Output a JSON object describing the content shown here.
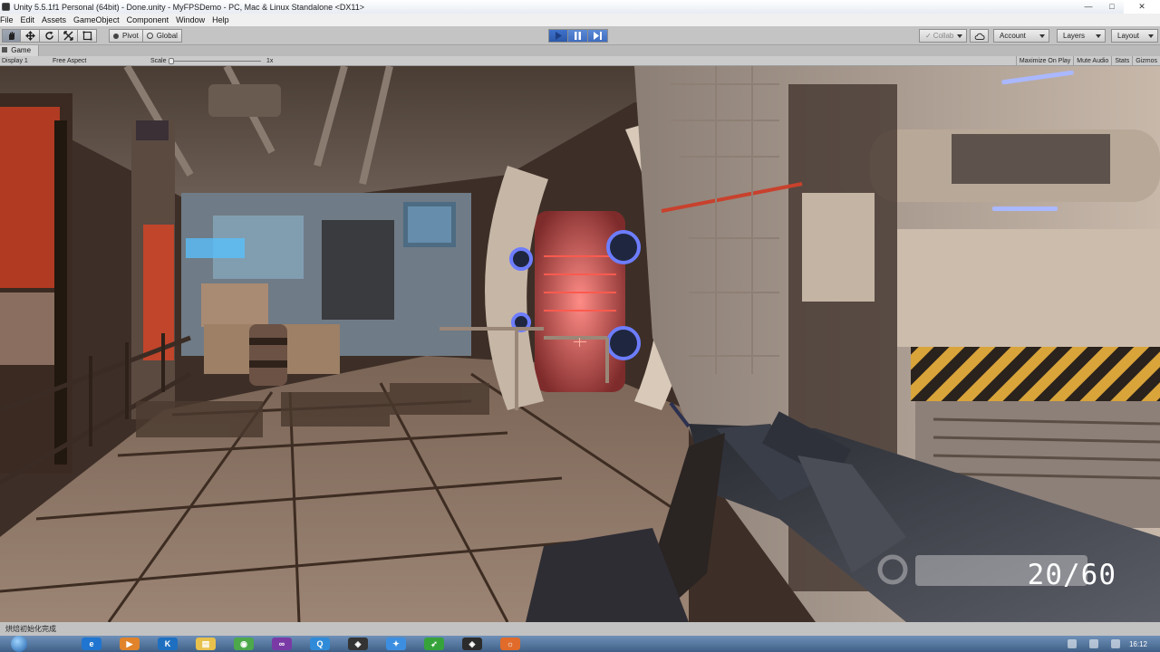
{
  "window": {
    "title": "Unity 5.5.1f1 Personal (64bit) - Done.unity - MyFPSDemo - PC, Mac & Linux Standalone <DX11>",
    "controls": [
      "—",
      "□",
      "✕"
    ]
  },
  "menu": [
    "File",
    "Edit",
    "Assets",
    "GameObject",
    "Component",
    "Window",
    "Help"
  ],
  "toolbar": {
    "pivot_label": "Pivot",
    "global_label": "Global",
    "collab_label": "Collab",
    "account_label": "Account",
    "layers_label": "Layers",
    "layout_label": "Layout",
    "play_state": "playing"
  },
  "game_panel": {
    "tab_label": "Game",
    "display_label": "Display 1",
    "aspect_label": "Free Aspect",
    "scale_label": "Scale",
    "scale_value": "1x",
    "options": [
      "Maximize On Play",
      "Mute Audio",
      "Stats",
      "Gizmos"
    ]
  },
  "hud": {
    "ammo": "20/60"
  },
  "statusbar": {
    "message": "烘焙初始化完成"
  },
  "taskbar": {
    "apps": [
      {
        "icon": "ie-icon",
        "glyph": "e",
        "color": "#1f75cf"
      },
      {
        "icon": "media-player-icon",
        "glyph": "▶",
        "color": "#e0832a"
      },
      {
        "icon": "k-app-icon",
        "glyph": "K",
        "color": "#1e6fc0"
      },
      {
        "icon": "folder-icon",
        "glyph": "▤",
        "color": "#e7c14b"
      },
      {
        "icon": "green-app-icon",
        "glyph": "◉",
        "color": "#4ca84a"
      },
      {
        "icon": "visual-studio-icon",
        "glyph": "∞",
        "color": "#7a3aa6"
      },
      {
        "icon": "qq-icon",
        "glyph": "Q",
        "color": "#2f8bd8"
      },
      {
        "icon": "unity-icon",
        "glyph": "◈",
        "color": "#333333"
      },
      {
        "icon": "blue-app-icon",
        "glyph": "✦",
        "color": "#3c8fe0"
      },
      {
        "icon": "green-arrow-icon",
        "glyph": "➶",
        "color": "#36a33a"
      },
      {
        "icon": "unity-icon-2",
        "glyph": "◈",
        "color": "#2b2b2b"
      },
      {
        "icon": "firefox-icon",
        "glyph": "☼",
        "color": "#e06b2a"
      }
    ],
    "clock": "16:12"
  }
}
